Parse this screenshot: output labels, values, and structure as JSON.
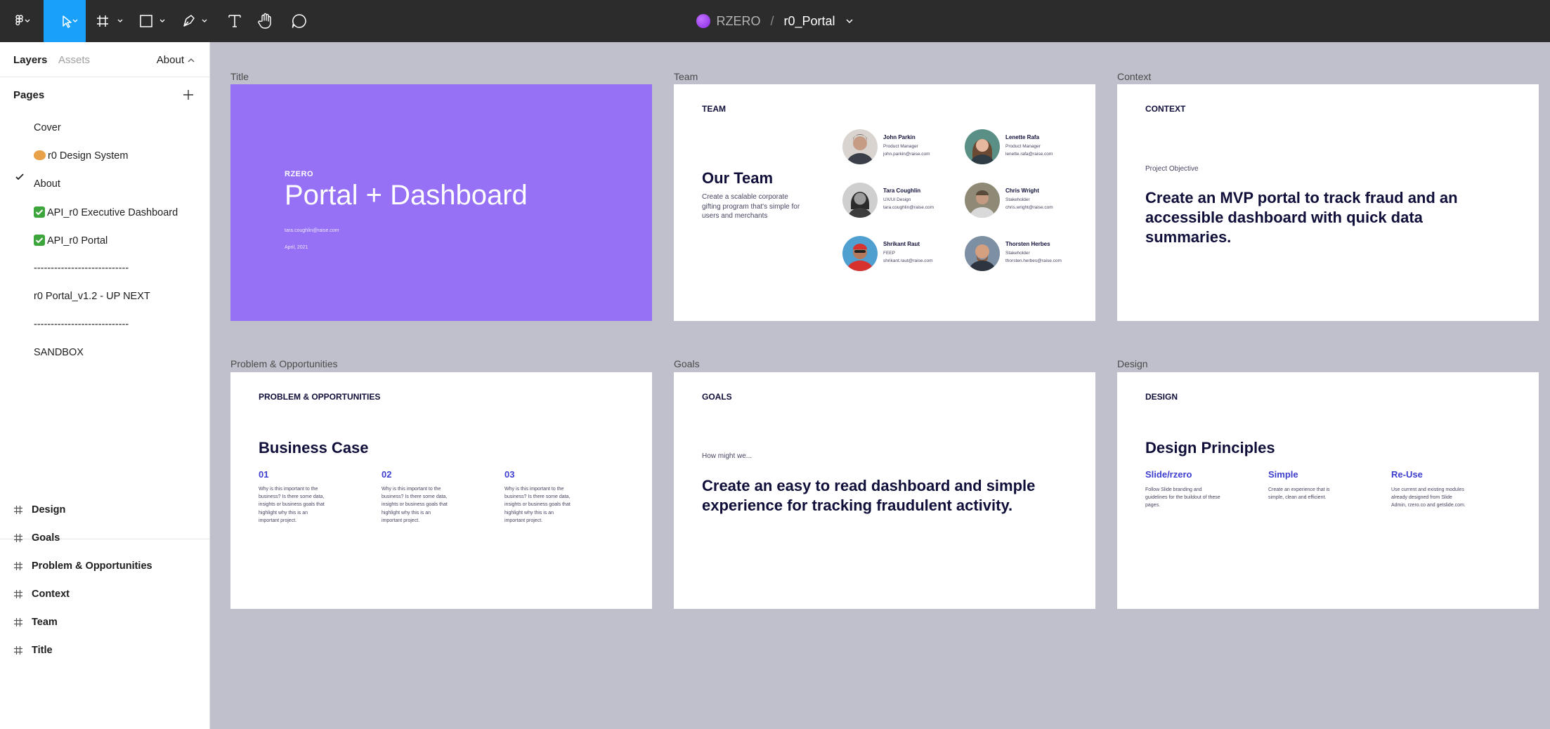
{
  "toolbar": {
    "main_menu_icon": "figma-logo-icon",
    "tools": [
      "move-tool",
      "frame-tool",
      "shape-tool",
      "pen-tool",
      "text-tool",
      "hand-tool",
      "comment-tool"
    ],
    "team_name": "RZERO",
    "separator": "/",
    "file_name": "r0_Portal"
  },
  "sidebar": {
    "tab_layers": "Layers",
    "tab_assets": "Assets",
    "current_page": "About",
    "pages_title": "Pages",
    "pages": [
      {
        "label": "Cover"
      },
      {
        "label": "r0 Design System"
      },
      {
        "label": "About"
      },
      {
        "label": "API_r0 Executive Dashboard"
      },
      {
        "label": "API_r0 Portal"
      },
      {
        "label": "----------------------------"
      },
      {
        "label": "r0 Portal_v1.2 - UP NEXT"
      },
      {
        "label": "----------------------------"
      },
      {
        "label": "SANDBOX"
      }
    ],
    "layers": [
      "Design",
      "Goals",
      "Problem & Opportunities",
      "Context",
      "Team",
      "Title"
    ]
  },
  "canvas": {
    "frames": {
      "title": {
        "label": "Title",
        "brand": "RZERO",
        "heading": "Portal + Dashboard",
        "email": "tara.coughlin@raise.com",
        "date": "April, 2021",
        "bg_color": "#9670f5"
      },
      "team": {
        "label": "Team",
        "slide_label": "TEAM",
        "heading": "Our Team",
        "description": "Create a scalable corporate gifting program that's simple for users and merchants",
        "members": [
          {
            "name": "John Parkin",
            "role": "Product Manager",
            "email": "john.parkin@raise.com"
          },
          {
            "name": "Lenette Rafa",
            "role": "Product Manager",
            "email": "lenette.rafa@raise.com"
          },
          {
            "name": "Tara Coughlin",
            "role": "UX/UI Design",
            "email": "tara.coughlin@raise.com"
          },
          {
            "name": "Chris Wright",
            "role": "Stakeholder",
            "email": "chris.wright@raise.com"
          },
          {
            "name": "Shrikant Raut",
            "role": "FEEP",
            "email": "shrikant.raut@raise.com"
          },
          {
            "name": "Thorsten Herbes",
            "role": "Stakeholder",
            "email": "thorsten.herbes@raise.com"
          }
        ]
      },
      "context": {
        "label": "Context",
        "slide_label": "CONTEXT",
        "objective_label": "Project Objective",
        "objective": "Create an MVP portal to track fraud and an accessible dashboard with quick data summaries."
      },
      "problems": {
        "label": "Problem & Opportunities",
        "slide_label": "PROBLEM & OPPORTUNITIES",
        "heading": "Business Case",
        "columns": [
          {
            "num": "01",
            "text": "Why is this important to the business? Is there some data, insights or business goals that highlight why this is an important project."
          },
          {
            "num": "02",
            "text": "Why is this important to the business? Is there some data, insights or business goals that highlight why this is an important project."
          },
          {
            "num": "03",
            "text": "Why is this important to the business? Is there some data, insights or business goals that highlight why this is an important project."
          }
        ]
      },
      "goals": {
        "label": "Goals",
        "slide_label": "GOALS",
        "prompt": "How might we...",
        "statement": "Create an easy to read dashboard and simple experience for tracking fraudulent activity."
      },
      "design": {
        "label": "Design",
        "slide_label": "DESIGN",
        "heading": "Design Principles",
        "principles": [
          {
            "title": "Slide/rzero",
            "text": "Follow Slide branding and guidelines for the buildout of these pages."
          },
          {
            "title": "Simple",
            "text": "Create an experience that is simple, clean and efficient."
          },
          {
            "title": "Re-Use",
            "text": "Use current and existing modules already designed from Slide Admin, rzero.co and getslide.com."
          }
        ]
      }
    }
  },
  "colors": {
    "toolbar_bg": "#2c2c2c",
    "active_tool": "#18a0fb",
    "canvas_bg": "#bfc0cb",
    "slide_accent": "#3d3dcf",
    "slide_text": "#0f0f3a"
  }
}
